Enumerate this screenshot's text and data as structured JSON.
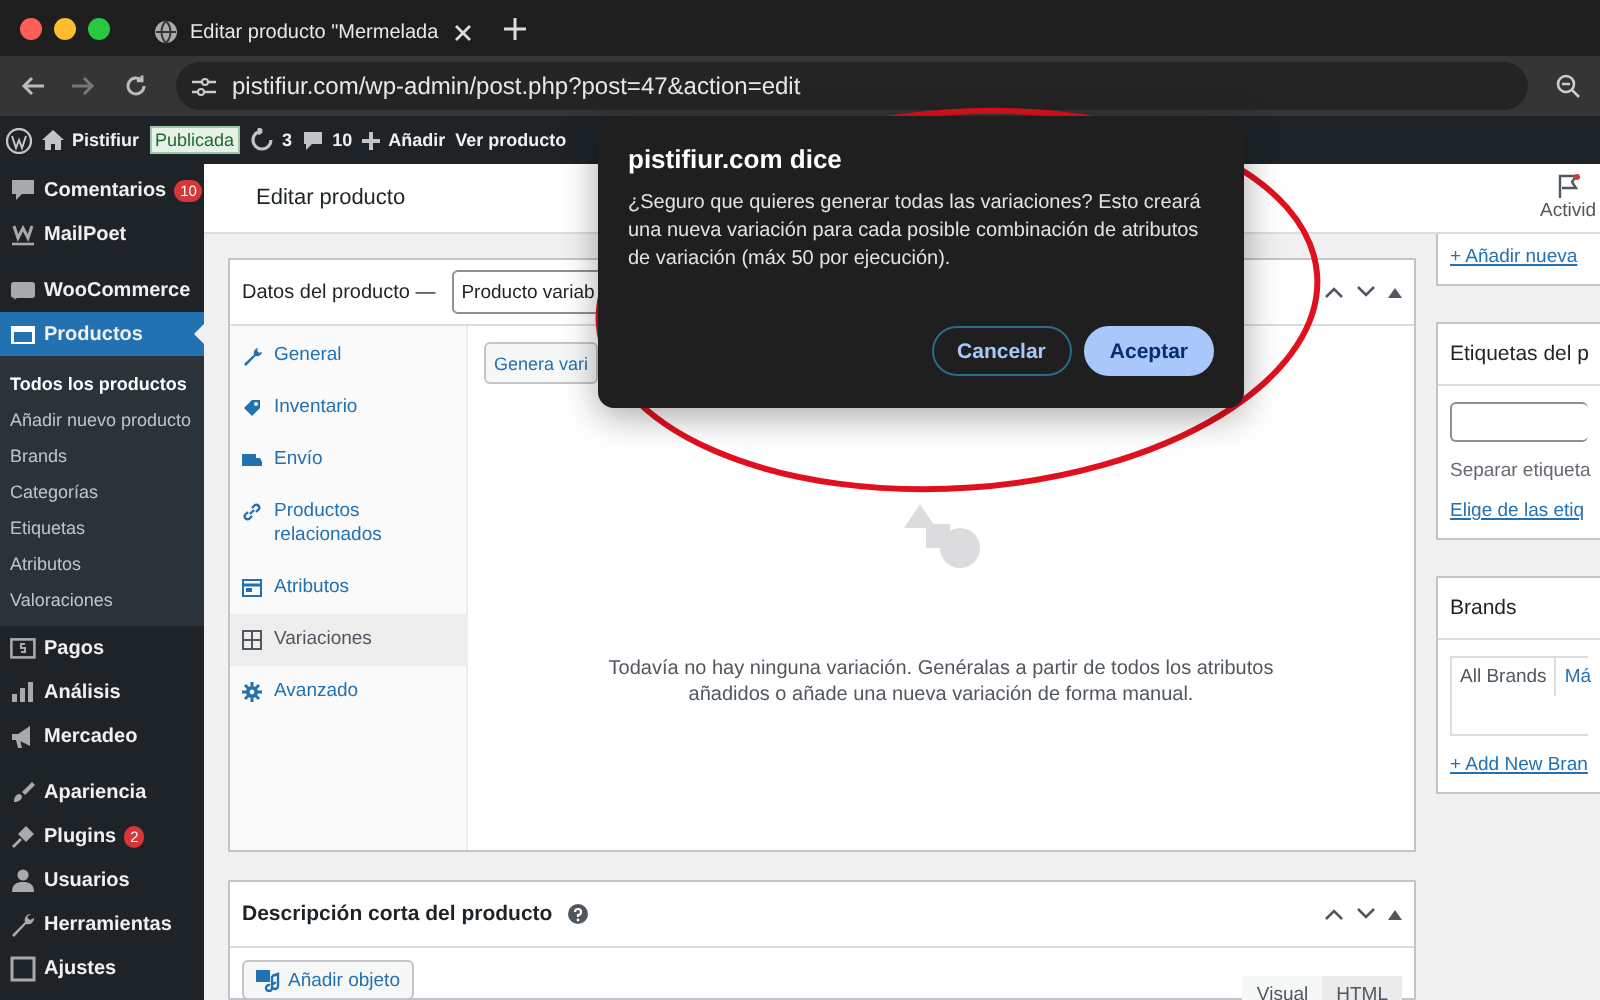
{
  "browser": {
    "tab_title": "Editar producto \"Mermelada",
    "url": "pistifiur.com/wp-admin/post.php?post=47&action=edit"
  },
  "admin_bar": {
    "site": "Pistifiur",
    "status_badge": "Publicada",
    "updates": "3",
    "comments": "10",
    "add_new": "Añadir",
    "view": "Ver producto"
  },
  "sidebar": {
    "groups": [
      {
        "items": [
          {
            "label": "Comentarios",
            "badge": "10",
            "selected": false
          },
          {
            "label": "MailPoet",
            "selected": false
          }
        ]
      },
      {
        "items": [
          {
            "label": "WooCommerce",
            "selected": false
          },
          {
            "label": "Productos",
            "selected": true,
            "children": [
              {
                "label": "Todos los productos",
                "selected": true
              },
              {
                "label": "Añadir nuevo producto",
                "selected": false
              },
              {
                "label": "Brands",
                "selected": false
              },
              {
                "label": "Categorías",
                "selected": false
              },
              {
                "label": "Etiquetas",
                "selected": false
              },
              {
                "label": "Atributos",
                "selected": false
              },
              {
                "label": "Valoraciones",
                "selected": false
              }
            ]
          },
          {
            "label": "Pagos",
            "selected": false
          },
          {
            "label": "Análisis",
            "selected": false
          },
          {
            "label": "Mercadeo",
            "selected": false
          }
        ]
      },
      {
        "items": [
          {
            "label": "Apariencia",
            "selected": false
          },
          {
            "label": "Plugins",
            "badge": "2",
            "selected": false
          },
          {
            "label": "Usuarios",
            "selected": false
          },
          {
            "label": "Herramientas",
            "selected": false
          },
          {
            "label": "Ajustes",
            "selected": false
          }
        ]
      }
    ]
  },
  "header": {
    "title": "Editar producto",
    "activity": "Activid"
  },
  "product_data": {
    "title": "Datos del producto —",
    "type_select": "Producto variab",
    "tabs": [
      {
        "label": "General",
        "selected": false
      },
      {
        "label": "Inventario",
        "selected": false
      },
      {
        "label": "Envío",
        "selected": false
      },
      {
        "label": "Productos relacionados",
        "selected": false
      },
      {
        "label": "Atributos",
        "selected": false
      },
      {
        "label": "Variaciones",
        "selected": true
      },
      {
        "label": "Avanzado",
        "selected": false
      }
    ],
    "generate_button": "Genera vari",
    "empty_message": "Todavía no hay ninguna variación. Genéralas a partir de todos los atributos añadidos o añade una nueva variación de forma manual."
  },
  "short_description": {
    "title": "Descripción corta del producto",
    "add_media": "Añadir objeto",
    "editor_tabs": [
      {
        "label": "Visual",
        "selected": false
      },
      {
        "label": "HTML",
        "selected": true
      }
    ]
  },
  "right_column": {
    "category_link": "+ Añadir nueva",
    "tags": {
      "title": "Etiquetas del p",
      "hint": "Separar etiqueta",
      "choose_link": "Elige de las etiq"
    },
    "brands": {
      "title": "Brands",
      "tabs": [
        {
          "label": "All Brands",
          "selected": true
        },
        {
          "label": "Má",
          "selected": false
        }
      ],
      "add_link": "+ Add New Bran"
    }
  },
  "dialog": {
    "title": "pistifiur.com dice",
    "message": "¿Seguro que quieres generar todas las variaciones? Esto creará una nueva variación para cada posible combinación de atributos de variación (máx 50 por ejecución).",
    "buttons": [
      {
        "label": "Cancelar",
        "kind": "secondary"
      },
      {
        "label": "Aceptar",
        "kind": "primary"
      }
    ]
  }
}
